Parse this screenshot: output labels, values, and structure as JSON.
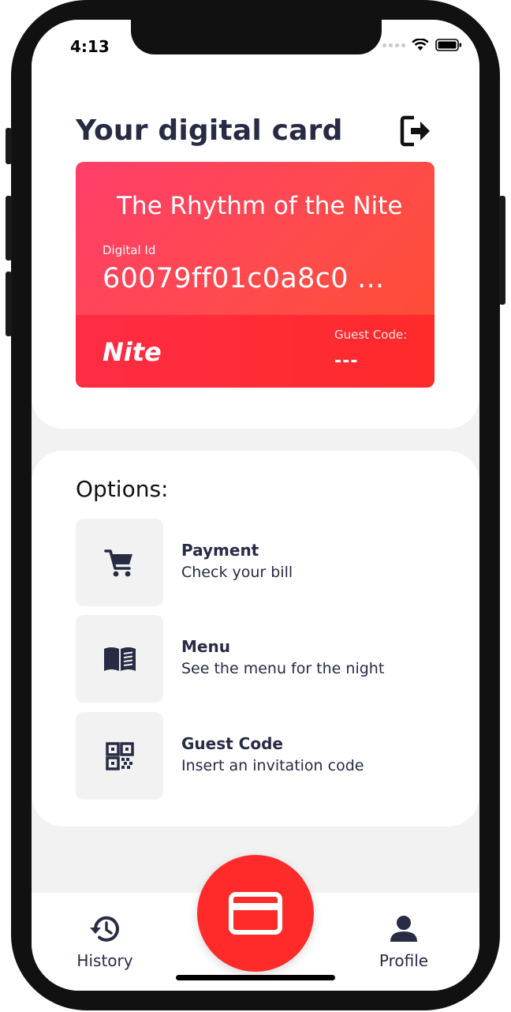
{
  "status_bar": {
    "time": "4:13"
  },
  "header": {
    "title": "Your digital card",
    "logout_icon": "logout-icon"
  },
  "card": {
    "name": "The Rhythm of the Nite",
    "digital_id_label": "Digital Id",
    "digital_id": "60079ff01c0a8c0 ...",
    "brand": "Nite",
    "guest_code_label": "Guest Code:",
    "guest_code_value": "---",
    "colors": {
      "gradient_start": "#ff3e6a",
      "gradient_end": "#ff4d2f",
      "bottom": "#ff2a2a"
    }
  },
  "options": {
    "title": "Options:",
    "items": [
      {
        "icon": "cart-icon",
        "title": "Payment",
        "subtitle": "Check your bill"
      },
      {
        "icon": "book-icon",
        "title": "Menu",
        "subtitle": "See the menu for the night"
      },
      {
        "icon": "qr-code-icon",
        "title": "Guest Code",
        "subtitle": "Insert an invitation code"
      }
    ]
  },
  "bottom_nav": {
    "items": [
      {
        "icon": "history-icon",
        "label": "History"
      },
      {
        "icon": "credit-card-icon",
        "label": ""
      },
      {
        "icon": "profile-icon",
        "label": "Profile"
      }
    ]
  },
  "colors": {
    "accent": "#ff2b2b",
    "text_dark": "#272b44",
    "panel_bg": "#f2f2f2"
  }
}
